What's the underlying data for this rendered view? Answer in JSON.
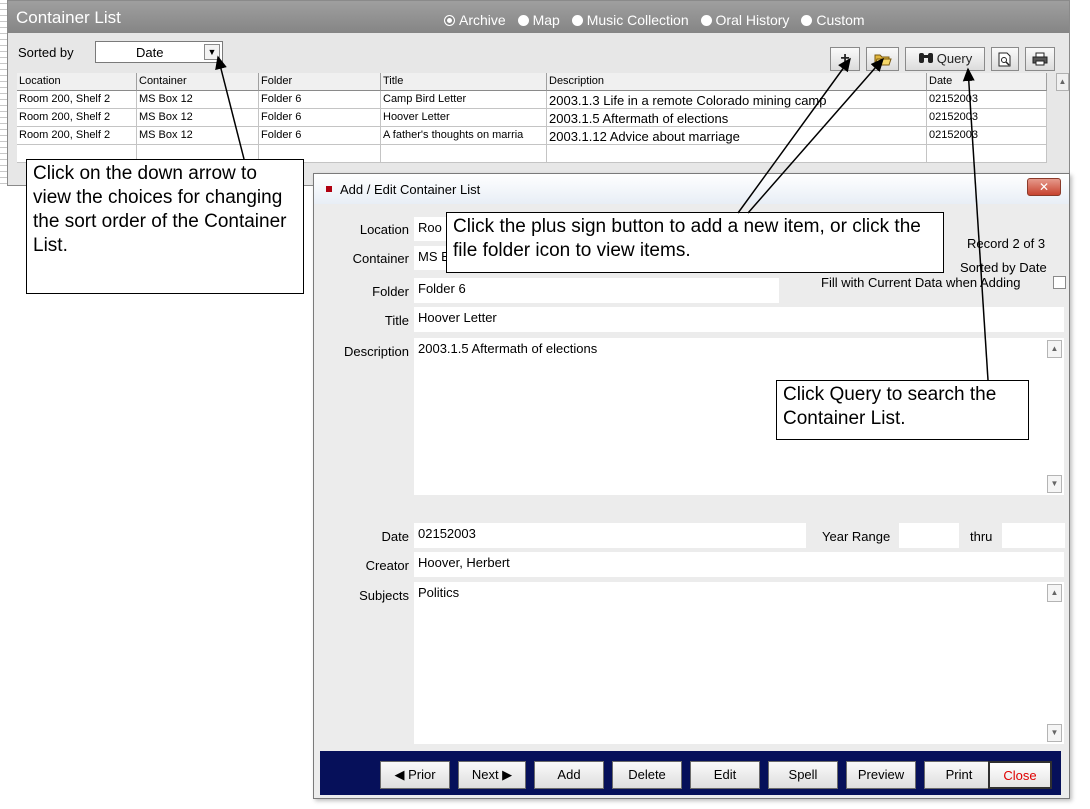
{
  "bg_window": {
    "title": "Container List",
    "radios": [
      {
        "label": "Archive",
        "selected": true
      },
      {
        "label": "Map",
        "selected": false
      },
      {
        "label": "Music Collection",
        "selected": false
      },
      {
        "label": "Oral History",
        "selected": false
      },
      {
        "label": "Custom",
        "selected": false
      }
    ],
    "sorted_by_label": "Sorted by",
    "sort_value": "Date",
    "toolbar": {
      "plus_icon": "+",
      "query_label": "Query"
    },
    "columns": [
      "Location",
      "Container",
      "Folder",
      "Title",
      "Description",
      "Date"
    ],
    "rows": [
      [
        "Room 200, Shelf 2",
        "MS Box 12",
        "Folder 6",
        "Camp Bird Letter",
        "2003.1.3 Life in a remote Colorado mining camp",
        "02152003"
      ],
      [
        "Room 200, Shelf 2",
        "MS Box 12",
        "Folder 6",
        "Hoover Letter",
        "2003.1.5 Aftermath of elections",
        "02152003"
      ],
      [
        "Room 200, Shelf 2",
        "MS Box 12",
        "Folder 6",
        "A father's thoughts on marria",
        "2003.1.12 Advice about marriage",
        "02152003"
      ]
    ]
  },
  "callouts": {
    "sort": "Click on the down arrow to view the choices for changing the sort order of the Container List.",
    "plus": "Click the plus sign button to add a new item, or click the file folder icon to view items.",
    "query": "Click Query to search the Container List."
  },
  "dialog": {
    "title": "Add / Edit Container List",
    "record_label": "Record 2 of 3",
    "sorted_label": "Sorted by Date",
    "fill_label": "Fill with Current Data when Adding",
    "fields": {
      "location_label": "Location",
      "location_value": "Roo",
      "container_label": "Container",
      "container_value": "MS E",
      "folder_label": "Folder",
      "folder_value": "Folder 6",
      "title_label": "Title",
      "title_value": "Hoover Letter",
      "description_label": "Description",
      "description_value": "2003.1.5 Aftermath of elections",
      "date_label": "Date",
      "date_value": "02152003",
      "year_range_label": "Year Range",
      "thru_label": "thru",
      "creator_label": "Creator",
      "creator_value": "Hoover, Herbert",
      "subjects_label": "Subjects",
      "subjects_value": "Politics"
    },
    "buttons": {
      "prior": "◀ Prior",
      "next": "Next ▶",
      "add": "Add",
      "delete": "Delete",
      "edit": "Edit",
      "spell": "Spell",
      "preview": "Preview",
      "print": "Print",
      "close": "Close"
    }
  }
}
